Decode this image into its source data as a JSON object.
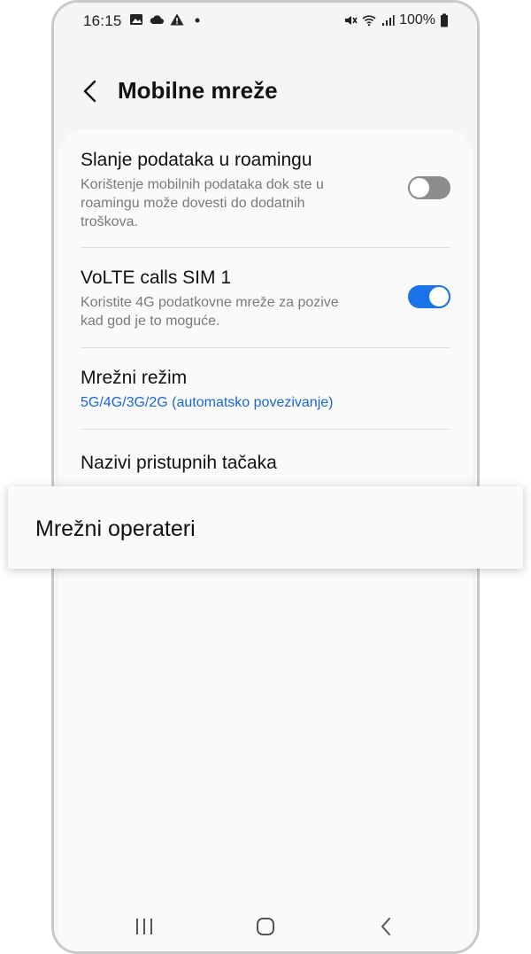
{
  "status_bar": {
    "time": "16:15",
    "battery": "100%"
  },
  "header": {
    "title": "Mobilne mreže"
  },
  "settings": {
    "roaming": {
      "title": "Slanje podataka u roamingu",
      "subtitle": "Korištenje mobilnih podataka dok ste u roamingu može dovesti do dodatnih troškova.",
      "enabled": false
    },
    "volte": {
      "title": "VoLTE calls SIM 1",
      "subtitle": "Koristite 4G podatkovne mreže za pozive kad god je to moguće.",
      "enabled": true
    },
    "network_mode": {
      "title": "Mrežni režim",
      "value": "5G/4G/3G/2G (automatsko povezivanje)"
    },
    "apn": {
      "title": "Nazivi pristupnih tačaka"
    }
  },
  "highlighted": {
    "label": "Mrežni operateri"
  },
  "colors": {
    "accent": "#1a73e8",
    "link": "#1967d2",
    "toggle_off": "#8c8c8c"
  }
}
